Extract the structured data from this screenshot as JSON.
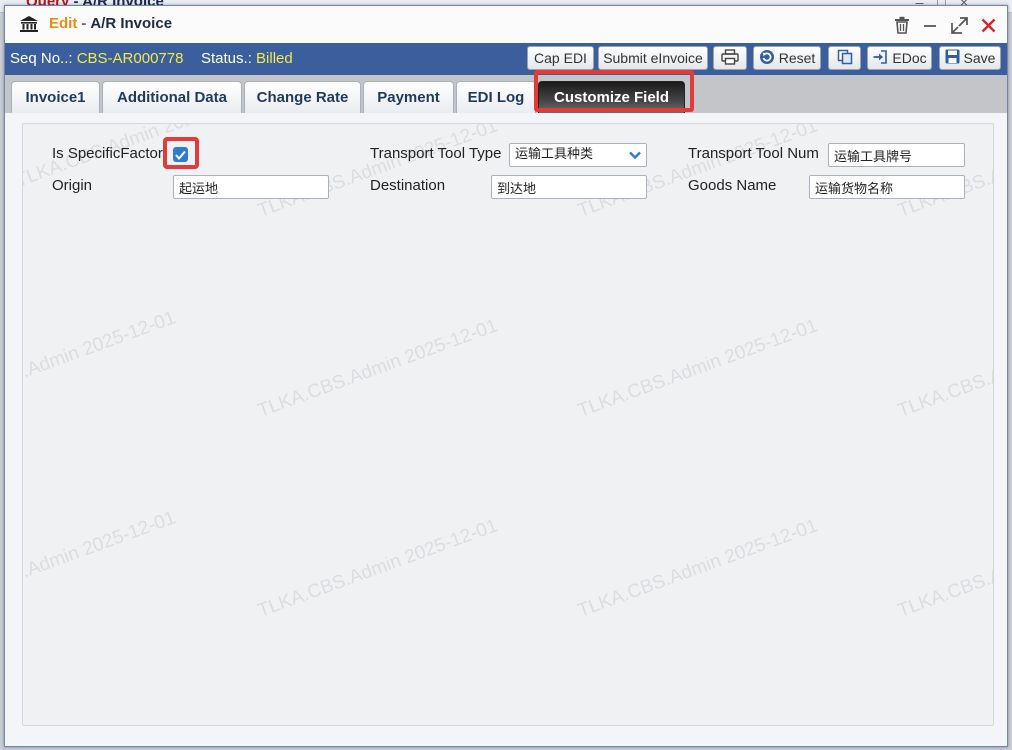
{
  "background_window": {
    "title_prefix": "Query",
    "title_rest": " - A/R Invoice"
  },
  "window": {
    "mode": "Edit",
    "separator": "-",
    "title": "A/R Invoice"
  },
  "header": {
    "seq_label": "Seq No..:",
    "seq_value": "CBS-AR000778",
    "status_label": "Status.:",
    "status_value": "Billed"
  },
  "toolbar": {
    "cap_edi": "Cap EDI",
    "submit_einvoice": "Submit eInvoice",
    "reset": "Reset",
    "edoc": "EDoc",
    "save": "Save"
  },
  "tabs": [
    {
      "label": "Invoice1"
    },
    {
      "label": "Additional Data"
    },
    {
      "label": "Change Rate"
    },
    {
      "label": "Payment"
    },
    {
      "label": "EDI Log"
    },
    {
      "label": "Customize Field",
      "active": true
    }
  ],
  "form": {
    "is_specific_factor": {
      "label": "Is SpecificFactor",
      "checked": true
    },
    "transport_tool_type": {
      "label": "Transport Tool Type",
      "value": "运输工具种类"
    },
    "transport_tool_num": {
      "label": "Transport Tool Num",
      "value": "运输工具牌号"
    },
    "origin": {
      "label": "Origin",
      "value": "起运地"
    },
    "destination": {
      "label": "Destination",
      "value": "到达地"
    },
    "goods_name": {
      "label": "Goods Name",
      "value": "运输货物名称"
    }
  },
  "watermark": {
    "text": "TLKA.CBS.Admin 2025-12-01"
  },
  "colors": {
    "toolbar_bg": "#3a5f9c",
    "status_value": "#f4e84a",
    "mode_text": "#f08c12",
    "highlight": "#e53a3a",
    "active_tab": "#2b2b2b",
    "checkbox": "#2f7bd6"
  }
}
